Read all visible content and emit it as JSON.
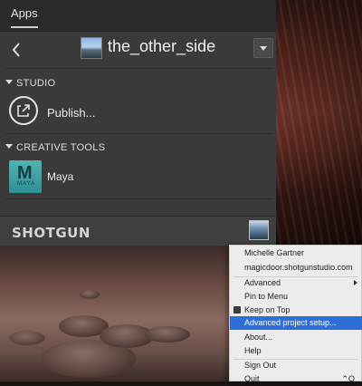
{
  "tabs": {
    "apps_label": "Apps"
  },
  "project": {
    "name": "the_other_side"
  },
  "sections": {
    "studio": {
      "label": "STUDIO",
      "items": [
        {
          "label": "Publish...",
          "icon": "publish-icon"
        }
      ]
    },
    "creative_tools": {
      "label": "CREATIVE TOOLS",
      "items": [
        {
          "label": "Maya",
          "icon": "maya-icon",
          "icon_text": "M",
          "icon_subtext": "MAYA"
        }
      ]
    }
  },
  "brand": {
    "logo_text": "SHOTGUN"
  },
  "menu": {
    "user_name": "Michelle Gartner",
    "site": "magicdoor.shotgunstudio.com",
    "items": [
      {
        "label": "Advanced",
        "has_submenu": true
      },
      {
        "label": "Pin to Menu"
      },
      {
        "label": "Keep on Top",
        "checked": true
      },
      {
        "label": "Advanced project setup...",
        "highlighted": true
      },
      {
        "label": "About..."
      },
      {
        "label": "Help"
      },
      {
        "label": "Sign Out"
      },
      {
        "label": "Quit",
        "shortcut": "⌃Q"
      }
    ]
  },
  "colors": {
    "panel_bg": "#3a3a3a",
    "menu_bg": "#ececec",
    "highlight": "#2d6fd7"
  }
}
